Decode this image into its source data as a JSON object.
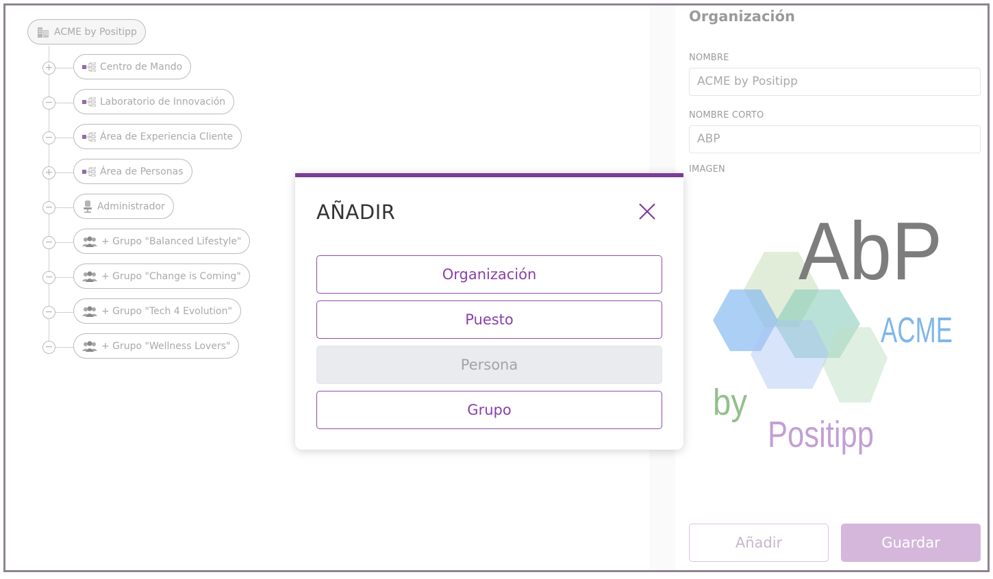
{
  "tree": {
    "root": {
      "label": "ACME by Positipp",
      "icon": "building-icon"
    },
    "children": [
      {
        "label": "Centro de Mando",
        "icon": "org-unit-icon",
        "toggle": "+"
      },
      {
        "label": "Laboratorio de Innovación",
        "icon": "org-unit-icon",
        "toggle": "−"
      },
      {
        "label": "Área de Experiencia Cliente",
        "icon": "org-unit-icon",
        "toggle": "−"
      },
      {
        "label": "Área de Personas",
        "icon": "org-unit-icon",
        "toggle": "+"
      },
      {
        "label": "Administrador",
        "icon": "office-chair-icon",
        "toggle": "−"
      },
      {
        "label": "+ Grupo \"Balanced Lifestyle\"",
        "icon": "group-icon",
        "toggle": "−"
      },
      {
        "label": "+ Grupo \"Change is Coming\"",
        "icon": "group-icon",
        "toggle": "−"
      },
      {
        "label": "+ Grupo \"Tech 4 Evolution\"",
        "icon": "group-icon",
        "toggle": "−"
      },
      {
        "label": "+ Grupo \"Wellness Lovers\"",
        "icon": "group-icon",
        "toggle": "−"
      }
    ]
  },
  "panel": {
    "title": "Organización",
    "name_label": "NOMBRE",
    "name_value": "ACME by Positipp",
    "short_label": "NOMBRE CORTO",
    "short_value": "ABP",
    "image_label": "IMAGEN",
    "logo": {
      "main": "AbP",
      "acme": "ACME",
      "by": "by",
      "brand": "Positipp"
    },
    "add_button": "Añadir",
    "save_button": "Guardar"
  },
  "modal": {
    "title": "AÑADIR",
    "options": [
      {
        "label": "Organización",
        "enabled": true
      },
      {
        "label": "Puesto",
        "enabled": true
      },
      {
        "label": "Persona",
        "enabled": false
      },
      {
        "label": "Grupo",
        "enabled": true
      }
    ]
  },
  "colors": {
    "accent": "#7c3d96",
    "accent_text": "#8a3fa6",
    "save_button": "#d5b7dc",
    "frame_border": "#8f8290"
  }
}
